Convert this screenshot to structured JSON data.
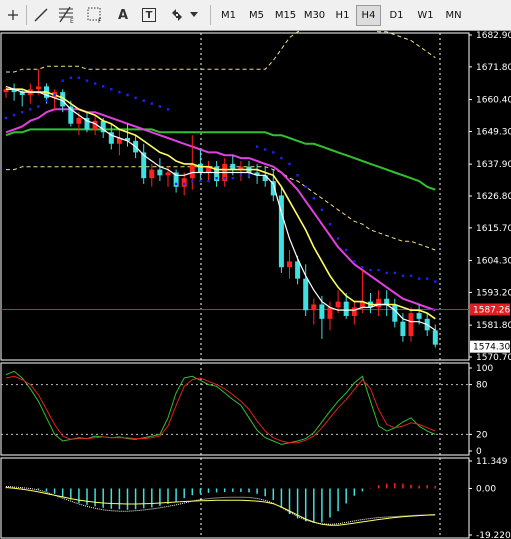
{
  "toolbar": {
    "icons": [
      "cursor-icon",
      "line-icon",
      "fibonacci-icon",
      "fibonacci-fan-icon",
      "text-icon",
      "text-label-icon",
      "arrows-icon",
      "dropdown-icon"
    ],
    "icon_glyphs": {
      "text": "A",
      "text_label": "T"
    },
    "timeframes": [
      "M1",
      "M5",
      "M15",
      "M30",
      "H1",
      "H4",
      "D1",
      "W1",
      "MN"
    ],
    "active_timeframe": "H4"
  },
  "chart_data": [
    {
      "type": "candlestick",
      "panel": "price",
      "y_ticks": [
        "1682.90",
        "1671.80",
        "1660.40",
        "1649.30",
        "1637.90",
        "1626.80",
        "1615.70",
        "1604.30",
        "1593.20",
        "1581.80",
        "1570.70"
      ],
      "ylim": [
        1570.7,
        1682.9
      ],
      "current_price_label": "1574.30",
      "horizontal_line_label": "1587.26",
      "horizontal_line_color": "#e02020",
      "colors": {
        "bull_candle": "#ff2020",
        "bear_candle": "#40e0e0",
        "ma_fast": "#ffffff",
        "ma_mid": "#ffff60",
        "ma_slow": "#e040e0",
        "ma_long": "#30c030",
        "parabolic_sar": "#2020ff",
        "envelope": "#f0e080"
      },
      "candles": [
        [
          1663,
          1665,
          1661,
          1664
        ],
        [
          1664,
          1666,
          1660,
          1663
        ],
        [
          1663,
          1664,
          1658,
          1662
        ],
        [
          1662,
          1666,
          1659,
          1664
        ],
        [
          1664,
          1671,
          1662,
          1665
        ],
        [
          1665,
          1666,
          1659,
          1661
        ],
        [
          1661,
          1664,
          1657,
          1663
        ],
        [
          1663,
          1664,
          1656,
          1658
        ],
        [
          1658,
          1660,
          1651,
          1652
        ],
        [
          1652,
          1656,
          1648,
          1654
        ],
        [
          1654,
          1656,
          1649,
          1650
        ],
        [
          1650,
          1655,
          1648,
          1653
        ],
        [
          1653,
          1654,
          1647,
          1649
        ],
        [
          1649,
          1652,
          1643,
          1645
        ],
        [
          1645,
          1650,
          1641,
          1647
        ],
        [
          1647,
          1652,
          1644,
          1646
        ],
        [
          1646,
          1648,
          1640,
          1642
        ],
        [
          1642,
          1645,
          1631,
          1633
        ],
        [
          1633,
          1638,
          1630,
          1636
        ],
        [
          1636,
          1640,
          1632,
          1634
        ],
        [
          1634,
          1637,
          1630,
          1635
        ],
        [
          1635,
          1636,
          1628,
          1630
        ],
        [
          1630,
          1635,
          1627,
          1633
        ],
        [
          1633,
          1648,
          1629,
          1638
        ],
        [
          1638,
          1643,
          1633,
          1635
        ],
        [
          1635,
          1639,
          1632,
          1637
        ],
        [
          1637,
          1639,
          1630,
          1632
        ],
        [
          1632,
          1640,
          1630,
          1638
        ],
        [
          1638,
          1641,
          1634,
          1636
        ],
        [
          1636,
          1639,
          1632,
          1637
        ],
        [
          1637,
          1639,
          1633,
          1635
        ],
        [
          1635,
          1638,
          1631,
          1634
        ],
        [
          1634,
          1637,
          1630,
          1632
        ],
        [
          1632,
          1636,
          1625,
          1627
        ],
        [
          1627,
          1630,
          1600,
          1602
        ],
        [
          1602,
          1608,
          1598,
          1604
        ],
        [
          1604,
          1606,
          1596,
          1598
        ],
        [
          1598,
          1603,
          1585,
          1587
        ],
        [
          1587,
          1591,
          1582,
          1589
        ],
        [
          1589,
          1592,
          1577,
          1584
        ],
        [
          1584,
          1590,
          1580,
          1588
        ],
        [
          1588,
          1594,
          1586,
          1590
        ],
        [
          1590,
          1593,
          1584,
          1585
        ],
        [
          1585,
          1590,
          1582,
          1588
        ],
        [
          1588,
          1601,
          1586,
          1590
        ],
        [
          1590,
          1593,
          1586,
          1588
        ],
        [
          1588,
          1594,
          1585,
          1591
        ],
        [
          1591,
          1594,
          1585,
          1589
        ],
        [
          1589,
          1591,
          1581,
          1583
        ],
        [
          1583,
          1586,
          1576,
          1578
        ],
        [
          1578,
          1588,
          1576,
          1586
        ],
        [
          1586,
          1589,
          1582,
          1584
        ],
        [
          1584,
          1586,
          1578,
          1580
        ],
        [
          1580,
          1582,
          1574,
          1575
        ]
      ],
      "ma_fast": [
        1665,
        1664,
        1663,
        1663,
        1663,
        1662,
        1661,
        1660,
        1657,
        1655,
        1653,
        1652,
        1650,
        1648,
        1647,
        1646,
        1644,
        1641,
        1639,
        1637,
        1636,
        1634,
        1634,
        1635,
        1635,
        1635,
        1635,
        1635,
        1635,
        1635,
        1635,
        1634,
        1634,
        1631,
        1621,
        1612,
        1605,
        1599,
        1594,
        1590,
        1588,
        1587,
        1587,
        1587,
        1588,
        1588,
        1589,
        1589,
        1587,
        1584,
        1583,
        1583,
        1582,
        1580
      ],
      "ma_mid": [
        1664,
        1664,
        1664,
        1663,
        1663,
        1663,
        1662,
        1661,
        1659,
        1657,
        1656,
        1655,
        1653,
        1652,
        1650,
        1649,
        1648,
        1646,
        1644,
        1642,
        1641,
        1639,
        1638,
        1638,
        1637,
        1637,
        1636,
        1636,
        1636,
        1636,
        1636,
        1636,
        1635,
        1634,
        1630,
        1625,
        1620,
        1615,
        1609,
        1604,
        1599,
        1595,
        1592,
        1590,
        1590,
        1589,
        1589,
        1589,
        1589,
        1588,
        1587,
        1587,
        1586,
        1584
      ],
      "ma_slow": [
        1649,
        1650,
        1651,
        1653,
        1654,
        1656,
        1657,
        1657,
        1657,
        1657,
        1656,
        1656,
        1655,
        1654,
        1653,
        1652,
        1651,
        1650,
        1649,
        1648,
        1647,
        1646,
        1645,
        1644,
        1643,
        1642,
        1642,
        1641,
        1641,
        1640,
        1640,
        1639,
        1638,
        1637,
        1635,
        1632,
        1629,
        1625,
        1621,
        1617,
        1613,
        1609,
        1606,
        1603,
        1601,
        1599,
        1597,
        1595,
        1593,
        1591,
        1590,
        1589,
        1588,
        1587
      ],
      "ma_long": [
        1648,
        1649,
        1649,
        1650,
        1650,
        1650,
        1650,
        1650,
        1650,
        1650,
        1650,
        1650,
        1650,
        1650,
        1650,
        1650,
        1650,
        1650,
        1650,
        1649,
        1649,
        1649,
        1649,
        1649,
        1649,
        1649,
        1649,
        1649,
        1649,
        1649,
        1649,
        1649,
        1649,
        1648,
        1648,
        1647,
        1646,
        1645,
        1645,
        1644,
        1643,
        1642,
        1641,
        1640,
        1639,
        1638,
        1637,
        1636,
        1635,
        1634,
        1633,
        1632,
        1630,
        1629
      ],
      "env_upper": [
        1670,
        1670,
        1671,
        1671,
        1671,
        1672,
        1672,
        1672,
        1672,
        1672,
        1671,
        1671,
        1671,
        1671,
        1671,
        1671,
        1671,
        1671,
        1671,
        1671,
        1671,
        1671,
        1671,
        1671,
        1671,
        1671,
        1671,
        1671,
        1671,
        1671,
        1671,
        1671,
        1671,
        1674,
        1678,
        1682,
        1684,
        1685,
        1686,
        1686,
        1686,
        1686,
        1686,
        1686,
        1685,
        1685,
        1684,
        1684,
        1683,
        1682,
        1681,
        1679,
        1677,
        1675
      ],
      "env_lower": [
        1636,
        1636,
        1637,
        1637,
        1637,
        1637,
        1637,
        1637,
        1637,
        1637,
        1637,
        1637,
        1637,
        1637,
        1637,
        1637,
        1637,
        1637,
        1637,
        1637,
        1637,
        1637,
        1637,
        1637,
        1637,
        1637,
        1637,
        1637,
        1637,
        1637,
        1637,
        1637,
        1637,
        1636,
        1635,
        1633,
        1632,
        1630,
        1628,
        1626,
        1624,
        1622,
        1620,
        1618,
        1617,
        1615,
        1614,
        1613,
        1612,
        1611,
        1611,
        1610,
        1609,
        1608
      ],
      "sar": [
        1654,
        1655,
        1656,
        1657,
        1658,
        1660,
        1662,
        1667,
        1668,
        1668,
        1667,
        1666,
        1665,
        1664,
        1663,
        1662,
        1661,
        1660,
        1659,
        1658,
        1657,
        1631,
        1631,
        1632,
        1632,
        1632,
        1633,
        1633,
        1633,
        1634,
        1634,
        1644,
        1643,
        1642,
        1640,
        1638,
        1634,
        1630,
        1626,
        1622,
        1617,
        1612,
        1608,
        1604,
        1602,
        1601,
        1601,
        1600,
        1600,
        1599,
        1599,
        1598,
        1598,
        1597
      ]
    },
    {
      "type": "line",
      "panel": "stochastic",
      "y_ticks": [
        "100",
        "80",
        "20",
        "0"
      ],
      "ylim": [
        0,
        100
      ],
      "levels": [
        80,
        20
      ],
      "series": [
        {
          "color": "#30c030",
          "values": [
            92,
            96,
            88,
            75,
            60,
            40,
            20,
            12,
            14,
            16,
            15,
            18,
            17,
            16,
            17,
            15,
            14,
            16,
            18,
            20,
            40,
            70,
            88,
            90,
            85,
            80,
            78,
            70,
            62,
            55,
            40,
            25,
            16,
            12,
            8,
            10,
            12,
            15,
            22,
            35,
            48,
            60,
            70,
            82,
            90,
            60,
            30,
            24,
            28,
            35,
            40,
            30,
            24,
            20
          ]
        },
        {
          "color": "#e02020",
          "values": [
            88,
            90,
            86,
            80,
            68,
            50,
            32,
            18,
            14,
            15,
            15,
            16,
            17,
            16,
            16,
            16,
            15,
            15,
            16,
            18,
            30,
            55,
            78,
            86,
            88,
            84,
            80,
            75,
            68,
            60,
            50,
            36,
            24,
            16,
            12,
            10,
            10,
            13,
            18,
            28,
            40,
            52,
            62,
            74,
            86,
            75,
            50,
            32,
            28,
            30,
            34,
            32,
            28,
            24
          ]
        }
      ]
    },
    {
      "type": "bar",
      "panel": "macd",
      "y_ticks": [
        "11.349",
        "0.00",
        "-19.2206"
      ],
      "ylim": [
        -19.2206,
        11.349
      ],
      "colors": {
        "histogram_neg": "#40e0e0",
        "histogram_pos": "#ff2020",
        "signal": "#ffffff",
        "main": "#ffff60"
      },
      "histogram": [
        0.8,
        0.6,
        0.4,
        0.2,
        -0.4,
        -1.2,
        -2.2,
        -3.4,
        -4.6,
        -6.0,
        -6.8,
        -7.4,
        -8.0,
        -8.4,
        -8.6,
        -8.8,
        -8.6,
        -8.2,
        -7.8,
        -7.2,
        -6.4,
        -5.4,
        -4.0,
        -2.8,
        -2.2,
        -1.8,
        -1.6,
        -1.5,
        -1.4,
        -1.4,
        -1.6,
        -2.2,
        -3.2,
        -4.8,
        -8.0,
        -10.6,
        -12.4,
        -13.6,
        -14.2,
        -14.0,
        -12.0,
        -9.4,
        -6.2,
        -3.0,
        -1.2,
        0.2,
        1.4,
        2.0,
        2.2,
        2.0,
        1.6,
        1.2,
        1.4,
        1.0
      ],
      "signal_line": [
        0.8,
        0.6,
        0.3,
        0.0,
        -0.6,
        -1.6,
        -2.8,
        -4.0,
        -5.2,
        -6.4,
        -7.4,
        -8.2,
        -8.8,
        -9.2,
        -9.4,
        -9.4,
        -9.2,
        -8.9,
        -8.5,
        -8.0,
        -7.4,
        -6.8,
        -6.0,
        -5.2,
        -4.6,
        -4.2,
        -3.9,
        -3.7,
        -3.6,
        -3.6,
        -3.7,
        -4.1,
        -4.9,
        -6.1,
        -7.8,
        -9.8,
        -11.6,
        -13.0,
        -14.0,
        -14.6,
        -14.8,
        -14.6,
        -14.0,
        -13.4,
        -12.8,
        -12.4,
        -12.0,
        -11.8,
        -11.6,
        -11.4,
        -11.2,
        -11.0,
        -10.9,
        -10.7
      ],
      "main_line": [
        0.4,
        0.1,
        -0.3,
        -0.8,
        -1.4,
        -2.1,
        -2.8,
        -3.5,
        -4.2,
        -4.8,
        -5.3,
        -5.7,
        -6.0,
        -6.2,
        -6.3,
        -6.4,
        -6.4,
        -6.3,
        -6.2,
        -6.0,
        -5.8,
        -5.6,
        -5.4,
        -5.2,
        -5.1,
        -5.0,
        -4.9,
        -4.9,
        -4.9,
        -4.9,
        -5.0,
        -5.2,
        -5.6,
        -6.3,
        -7.6,
        -9.3,
        -11.0,
        -12.6,
        -13.9,
        -14.8,
        -15.2,
        -15.2,
        -14.8,
        -14.3,
        -13.8,
        -13.3,
        -12.8,
        -12.4,
        -12.0,
        -11.7,
        -11.4,
        -11.2,
        -11.0,
        -10.9
      ]
    }
  ]
}
